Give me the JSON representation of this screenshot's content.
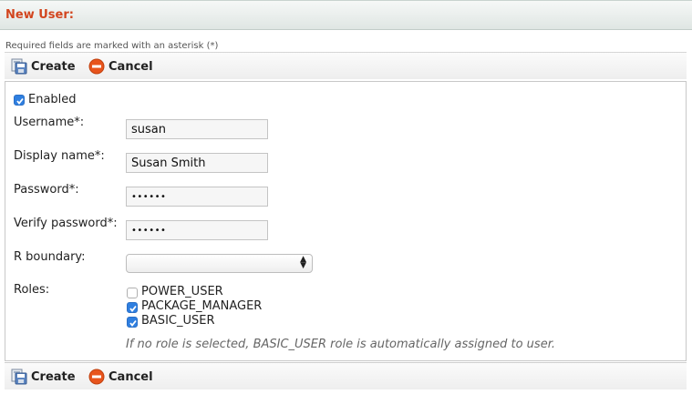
{
  "header": {
    "title": "New User:"
  },
  "required_note": "Required fields are marked with an asterisk (*)",
  "toolbar": {
    "create_label": "Create",
    "cancel_label": "Cancel"
  },
  "form": {
    "enabled": {
      "label": "Enabled",
      "checked": true
    },
    "username": {
      "label": "Username*:",
      "value": "susan"
    },
    "display_name": {
      "label": "Display name*:",
      "value": "Susan Smith"
    },
    "password": {
      "label": "Password*:",
      "value": "••••••"
    },
    "verify_password": {
      "label": "Verify password*:",
      "value": "••••••"
    },
    "r_boundary": {
      "label": "R boundary:",
      "value": ""
    },
    "roles": {
      "label": "Roles:",
      "items": [
        {
          "name": "POWER_USER",
          "checked": false
        },
        {
          "name": "PACKAGE_MANAGER",
          "checked": true
        },
        {
          "name": "BASIC_USER",
          "checked": true
        }
      ],
      "hint": "If no role is selected, BASIC_USER role is automatically assigned to user."
    }
  },
  "colors": {
    "title": "#d2451e",
    "checkbox_checked": "#2f7fe0",
    "cancel_icon": "#e8541c"
  }
}
